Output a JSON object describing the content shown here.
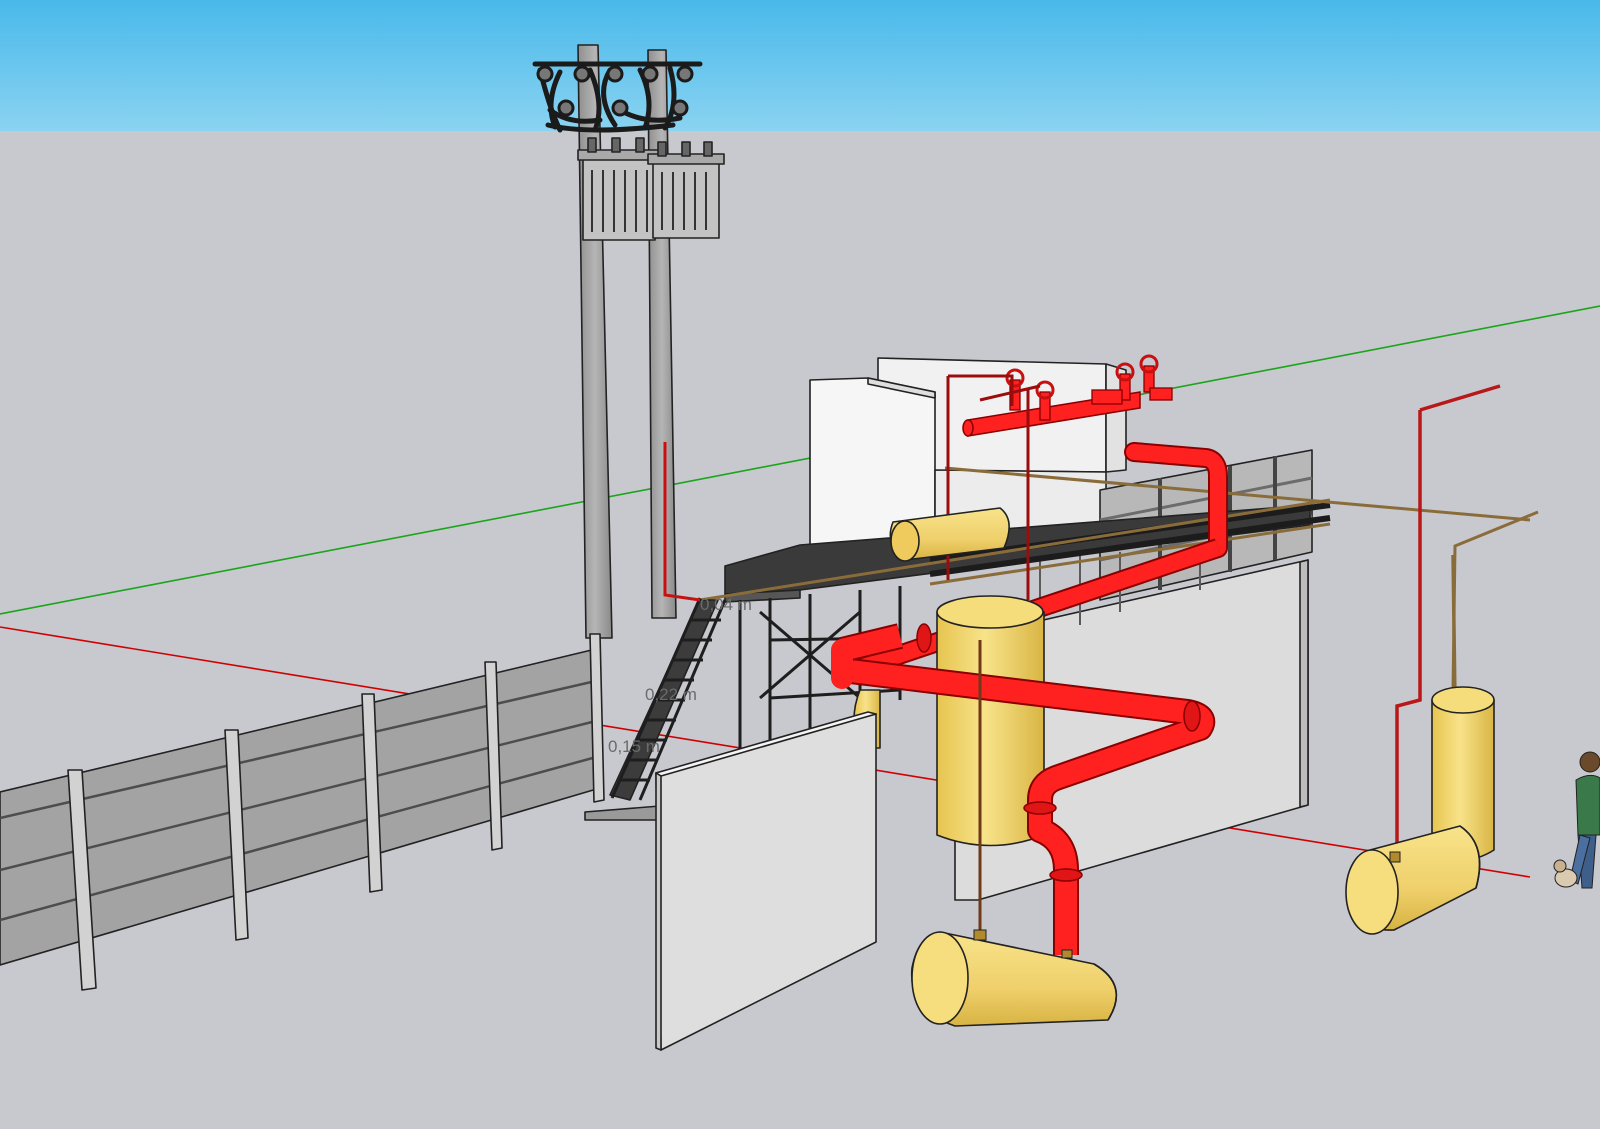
{
  "viewport": {
    "sky_color": "#5fc3ec",
    "ground_color": "#c8c8ce",
    "axis_red": "#d00000",
    "axis_green": "#00a000"
  },
  "dimensions": [
    {
      "label": "0,04 m"
    },
    {
      "label": "0,22 m"
    },
    {
      "label": "0,15 m"
    }
  ],
  "colors": {
    "pipe": "#ff1a1a",
    "tank": "#f2d56b",
    "wall": "#dcdcdc",
    "fence": "#9e9e9e",
    "pole": "#a3a3a3",
    "transformer": "#bdbdbd"
  },
  "icons": {
    "person": "person-figure-icon",
    "cat": "cat-figure-icon"
  }
}
